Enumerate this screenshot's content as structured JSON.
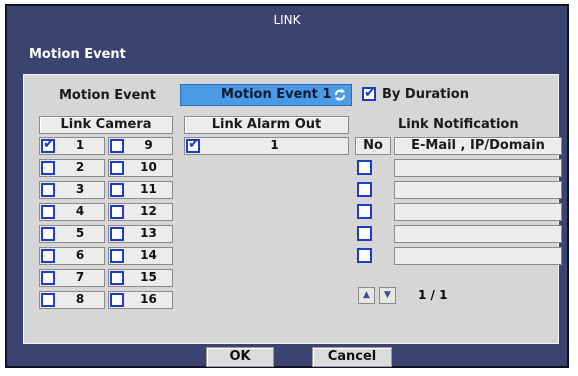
{
  "window": {
    "title": "LINK",
    "section": "Motion Event"
  },
  "event": {
    "label": "Motion Event",
    "selected": "Motion Event 1",
    "by_duration_label": "By Duration",
    "by_duration_checked": true
  },
  "link_camera": {
    "header": "Link Camera",
    "left": [
      {
        "num": "1",
        "checked": true
      },
      {
        "num": "2",
        "checked": false
      },
      {
        "num": "3",
        "checked": false
      },
      {
        "num": "4",
        "checked": false
      },
      {
        "num": "5",
        "checked": false
      },
      {
        "num": "6",
        "checked": false
      },
      {
        "num": "7",
        "checked": false
      },
      {
        "num": "8",
        "checked": false
      }
    ],
    "right": [
      {
        "num": "9",
        "checked": false
      },
      {
        "num": "10",
        "checked": false
      },
      {
        "num": "11",
        "checked": false
      },
      {
        "num": "12",
        "checked": false
      },
      {
        "num": "13",
        "checked": false
      },
      {
        "num": "14",
        "checked": false
      },
      {
        "num": "15",
        "checked": false
      },
      {
        "num": "16",
        "checked": false
      }
    ]
  },
  "link_alarm_out": {
    "header": "Link Alarm Out",
    "items": [
      {
        "num": "1",
        "checked": true
      }
    ]
  },
  "link_notification": {
    "header": "Link Notification",
    "col_no": "No",
    "col_target": "E-Mail , IP/Domain",
    "rows": [
      {
        "checked": false,
        "value": ""
      },
      {
        "checked": false,
        "value": ""
      },
      {
        "checked": false,
        "value": ""
      },
      {
        "checked": false,
        "value": ""
      },
      {
        "checked": false,
        "value": ""
      }
    ],
    "page": "1 / 1"
  },
  "buttons": {
    "ok": "OK",
    "cancel": "Cancel"
  },
  "colors": {
    "accent": "#4a9ae6",
    "window_bg": "#3b4470",
    "panel_bg": "#d6d6d6",
    "checkbox": "#1d3cc9"
  }
}
